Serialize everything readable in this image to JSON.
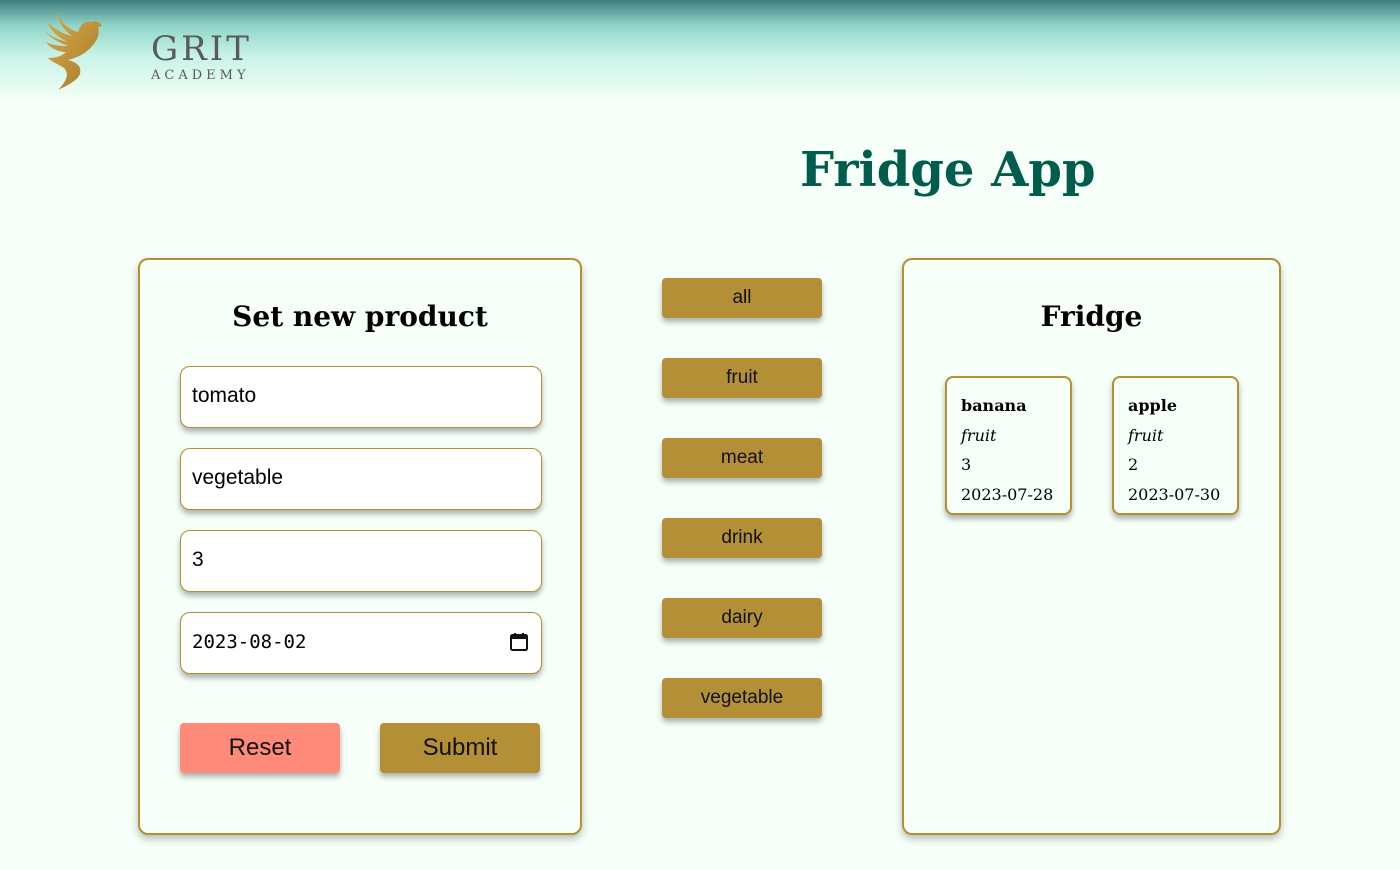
{
  "header": {
    "logo": {
      "icon": "phoenix-icon",
      "brand": "GRIT",
      "subtitle": "ACADEMY"
    }
  },
  "title": "Fridge App",
  "form": {
    "heading": "Set new product",
    "name_value": "tomato",
    "category_value": "vegetable",
    "quantity_value": "3",
    "date_value": "2023-08-02",
    "date_icon": "calendar-icon",
    "reset_label": "Reset",
    "submit_label": "Submit"
  },
  "filters": [
    "all",
    "fruit",
    "meat",
    "drink",
    "dairy",
    "vegetable"
  ],
  "fridge": {
    "heading": "Fridge",
    "items": [
      {
        "name": "banana",
        "category": "fruit",
        "quantity": "3",
        "date": "2023-07-28"
      },
      {
        "name": "apple",
        "category": "fruit",
        "quantity": "2",
        "date": "2023-07-30"
      }
    ]
  },
  "colors": {
    "accent": "#b38f35",
    "reset": "#ff8a7a",
    "title": "#005c4b",
    "background": "#f6fff8"
  }
}
